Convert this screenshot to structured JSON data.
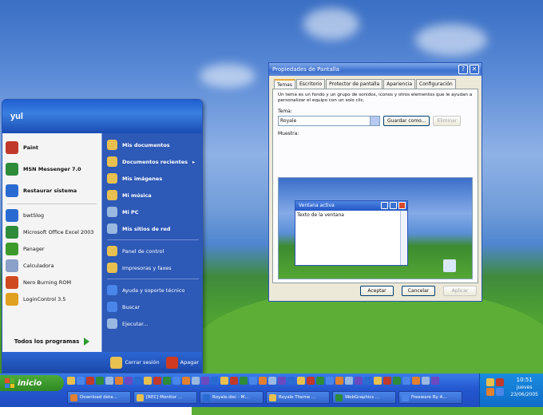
{
  "start_menu": {
    "user": "yul",
    "pinned": [
      {
        "label": "Paint",
        "icon": "paint-icon",
        "color": "#c0392b"
      },
      {
        "label": "MSN Messenger 7.0",
        "icon": "msn-icon",
        "color": "#2e8b3a"
      },
      {
        "label": "Restaurar sistema",
        "icon": "restore-icon",
        "color": "#2a6bd2"
      }
    ],
    "recent": [
      {
        "label": "bwtSlog",
        "icon": "app-icon",
        "color": "#2a6bd2"
      },
      {
        "label": "Microsoft Office Excel 2003",
        "icon": "excel-icon",
        "color": "#2e8b3a"
      },
      {
        "label": "Panager",
        "icon": "tree-icon",
        "color": "#3c9a2a"
      },
      {
        "label": "Calculadora",
        "icon": "calculator-icon",
        "color": "#8aa0c8"
      },
      {
        "label": "Nero Burning ROM",
        "icon": "nero-icon",
        "color": "#d04a20"
      },
      {
        "label": "LoginControl 3.5",
        "icon": "login-icon",
        "color": "#e0a020"
      }
    ],
    "all_programs": "Todos los programas",
    "right": [
      {
        "label": "Mis documentos",
        "icon": "folder-icon",
        "color": "#e8c050",
        "style": "bold"
      },
      {
        "label": "Documentos recientes",
        "icon": "folder-icon",
        "color": "#e8c050",
        "style": "bold",
        "arrow": "▸"
      },
      {
        "label": "Mis imágenes",
        "icon": "folder-icon",
        "color": "#e8c050",
        "style": "bold"
      },
      {
        "label": "Mi música",
        "icon": "folder-icon",
        "color": "#e8c050",
        "style": "bold"
      },
      {
        "label": "Mi PC",
        "icon": "computer-icon",
        "color": "#9ab8e0",
        "style": "bold"
      },
      {
        "label": "Mis sitios de red",
        "icon": "network-icon",
        "color": "#9ab8e0",
        "style": "bold"
      },
      {
        "label": "Panel de control",
        "icon": "folder-icon",
        "color": "#e8c050",
        "style": "small"
      },
      {
        "label": "Impresoras y faxes",
        "icon": "folder-icon",
        "color": "#e8c050",
        "style": "small"
      },
      {
        "label": "Ayuda y soporte técnico",
        "icon": "help-icon",
        "color": "#4a86ea",
        "style": "small"
      },
      {
        "label": "Buscar",
        "icon": "search-icon",
        "color": "#4a86ea",
        "style": "small"
      },
      {
        "label": "Ejecutar...",
        "icon": "run-icon",
        "color": "#9ab8e0",
        "style": "small"
      }
    ],
    "logoff": "Cerrar sesión",
    "shutdown": "Apagar"
  },
  "dialog": {
    "title": "Propiedades de Pantalla",
    "tabs": [
      "Temas",
      "Escritorio",
      "Protector de pantalla",
      "Apariencia",
      "Configuración"
    ],
    "description": "Un tema es un fondo y un grupo de sonidos, iconos y otros elementos que le ayudan a personalizar el equipo con un solo clic.",
    "theme_label": "Tema:",
    "theme_value": "Royale",
    "save_as": "Guardar como...",
    "delete": "Eliminar",
    "sample_label": "Muestra:",
    "sample_window_title": "Ventana activa",
    "sample_window_text": "Texto de la ventana",
    "ok": "Aceptar",
    "cancel": "Cancelar",
    "apply": "Aplicar"
  },
  "taskbar": {
    "start_label": "inicio",
    "tasks": [
      {
        "label": "Download deta...",
        "color": "#e08030"
      },
      {
        "label": "[REC] Monitor ...",
        "color": "#e8c050"
      },
      {
        "label": "Royale.doc - M...",
        "color": "#2a6bd2"
      },
      {
        "label": "Royale Theme ...",
        "color": "#e8c050"
      },
      {
        "label": "WebGraphics ...",
        "color": "#2e8b3a"
      },
      {
        "label": "Freeware By A...",
        "color": "#4a86ea"
      }
    ],
    "quick_launch_colors": [
      "#e8c050",
      "#4a86ea",
      "#c0392b",
      "#2e8b3a",
      "#9ab8e0",
      "#e08030",
      "#6a4ac0",
      "#2a6bd2",
      "#e8c050",
      "#c0392b",
      "#2e8b3a",
      "#4a86ea",
      "#e08030",
      "#9ab8e0",
      "#6a4ac0",
      "#2a6bd2",
      "#e8c050",
      "#c0392b",
      "#2e8b3a",
      "#4a86ea",
      "#e08030",
      "#9ab8e0",
      "#6a4ac0",
      "#2a6bd2",
      "#e8c050",
      "#c0392b",
      "#2e8b3a",
      "#4a86ea",
      "#e08030",
      "#9ab8e0",
      "#6a4ac0",
      "#2a6bd2",
      "#e8c050",
      "#c0392b",
      "#2e8b3a",
      "#4a86ea",
      "#e08030",
      "#9ab8e0",
      "#6a4ac0"
    ],
    "clock_time": "10:51",
    "clock_day": "jueves",
    "clock_date": "23/06/2005"
  }
}
